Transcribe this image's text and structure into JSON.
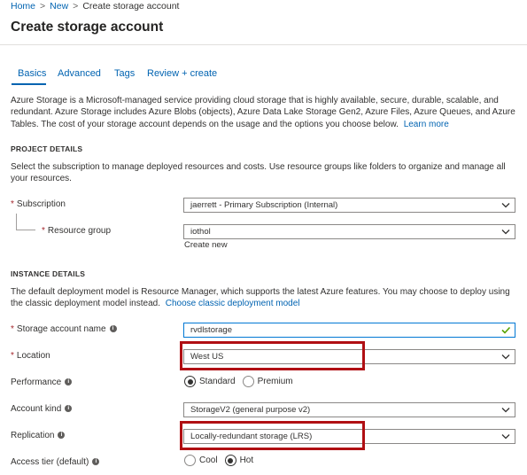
{
  "breadcrumb": {
    "home": "Home",
    "new": "New",
    "current": "Create storage account",
    "separator": ">"
  },
  "page": {
    "title": "Create storage account"
  },
  "tabs": [
    {
      "label": "Basics",
      "active": true
    },
    {
      "label": "Advanced",
      "active": false
    },
    {
      "label": "Tags",
      "active": false
    },
    {
      "label": "Review + create",
      "active": false
    }
  ],
  "intro": {
    "text": "Azure Storage is a Microsoft-managed service providing cloud storage that is highly available, secure, durable, scalable, and redundant. Azure Storage includes Azure Blobs (objects), Azure Data Lake Storage Gen2, Azure Files, Azure Queues, and Azure Tables. The cost of your storage account depends on the usage and the options you choose below.",
    "link": "Learn more"
  },
  "project": {
    "heading": "PROJECT DETAILS",
    "description": "Select the subscription to manage deployed resources and costs. Use resource groups like folders to organize and manage all your resources.",
    "subscription_label": "Subscription",
    "subscription_value": "jaerrett - Primary Subscription (Internal)",
    "resource_group_label": "Resource group",
    "resource_group_value": "iothol",
    "create_new": "Create new"
  },
  "instance": {
    "heading": "INSTANCE DETAILS",
    "description": "The default deployment model is Resource Manager, which supports the latest Azure features. You may choose to deploy using the classic deployment model instead.",
    "classic_link": "Choose classic deployment model",
    "name_label": "Storage account name",
    "name_value": "rvdlstorage",
    "location_label": "Location",
    "location_value": "West US",
    "performance_label": "Performance",
    "performance_options": [
      "Standard",
      "Premium"
    ],
    "performance_selected": "Standard",
    "kind_label": "Account kind",
    "kind_value": "StorageV2 (general purpose v2)",
    "replication_label": "Replication",
    "replication_value": "Locally-redundant storage (LRS)",
    "tier_label": "Access tier (default)",
    "tier_options": [
      "Cool",
      "Hot"
    ],
    "tier_selected": "Hot"
  },
  "colors": {
    "link": "#0063b1",
    "required": "#a4262c",
    "highlight": "#b00f13",
    "valid_check": "#57a300"
  }
}
